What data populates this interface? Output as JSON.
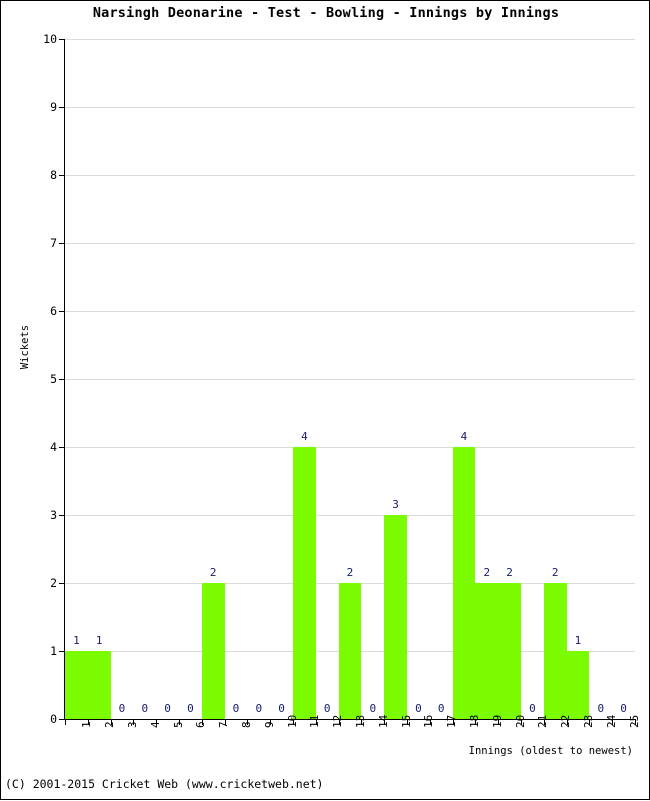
{
  "chart_data": {
    "type": "bar",
    "title": "Narsingh Deonarine - Test - Bowling - Innings by Innings",
    "xlabel": "Innings (oldest to newest)",
    "ylabel": "Wickets",
    "categories": [
      "1",
      "2",
      "3",
      "4",
      "5",
      "6",
      "7",
      "8",
      "9",
      "10",
      "11",
      "12",
      "13",
      "14",
      "15",
      "16",
      "17",
      "18",
      "19",
      "20",
      "21",
      "22",
      "23",
      "24",
      "25"
    ],
    "values": [
      1,
      1,
      0,
      0,
      0,
      0,
      2,
      0,
      0,
      0,
      4,
      0,
      2,
      0,
      3,
      0,
      0,
      4,
      2,
      2,
      0,
      2,
      1,
      0,
      0
    ],
    "data_labels": [
      "1",
      "1",
      "0",
      "0",
      "0",
      "0",
      "2",
      "0",
      "0",
      "0",
      "4",
      "0",
      "2",
      "0",
      "3",
      "0",
      "0",
      "4",
      "2",
      "2",
      "0",
      "2",
      "1",
      "0",
      "0"
    ],
    "ylim": [
      0,
      10
    ],
    "y_ticks": [
      0,
      1,
      2,
      3,
      4,
      5,
      6,
      7,
      8,
      9,
      10
    ],
    "y_tick_labels": [
      "0",
      "1",
      "2",
      "3",
      "4",
      "5",
      "6",
      "7",
      "8",
      "9",
      "10"
    ],
    "grid": true,
    "legend": false,
    "bar_color": "#7CFC00",
    "label_color": "#191970",
    "grid_color": "#DCDCDC",
    "axis_color": "#000000",
    "background_color": "#FFFFFF"
  },
  "footer": {
    "copyright": "(C) 2001-2015 Cricket Web (www.cricketweb.net)"
  }
}
